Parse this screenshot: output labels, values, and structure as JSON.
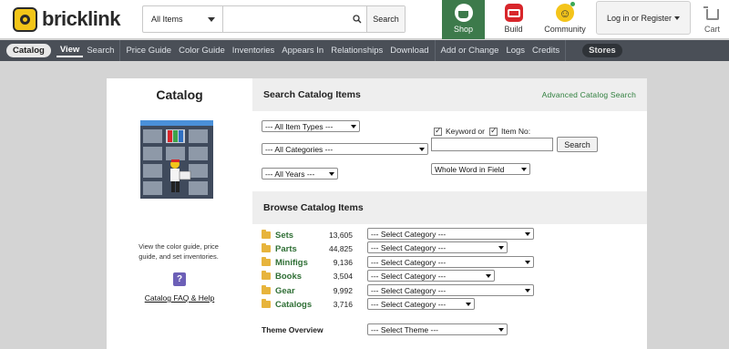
{
  "brand": {
    "name": "bricklink"
  },
  "header": {
    "search_type": "All Items",
    "search_placeholder": "",
    "search_button": "Search",
    "tiles": [
      {
        "label": "Shop",
        "icon": "shopping-bag-icon",
        "color": "#3d7a4b"
      },
      {
        "label": "Build",
        "icon": "toolbox-icon",
        "color": "#d8262b"
      },
      {
        "label": "Community",
        "icon": "smiley-icon",
        "color": "#f4c41a"
      }
    ],
    "login_label": "Log in or Register",
    "cart_label": "Cart"
  },
  "subnav": {
    "catalog": "Catalog",
    "view": "View",
    "search": "Search",
    "price_guide": "Price Guide",
    "color_guide": "Color Guide",
    "inventories": "Inventories",
    "appears_in": "Appears In",
    "relationships": "Relationships",
    "download": "Download",
    "add_or_change": "Add or Change",
    "logs": "Logs",
    "credits": "Credits",
    "stores": "Stores"
  },
  "left": {
    "title": "Catalog",
    "description": "View the color guide, price guide, and set inventories.",
    "faq_link": "Catalog FAQ & Help"
  },
  "search_section": {
    "title": "Search Catalog Items",
    "advanced_link": "Advanced Catalog Search",
    "item_types": "--- All Item Types ---",
    "categories": "--- All Categories ---",
    "years": "--- All Years ---",
    "keyword_label": "Keyword or",
    "item_no_label": "Item No:",
    "keyword_value": "",
    "search_button": "Search",
    "match_mode": "Whole Word in Field"
  },
  "browse_section": {
    "title": "Browse Catalog Items",
    "rows": [
      {
        "name": "Sets",
        "count": "13,605",
        "select": "--- Select Category ---"
      },
      {
        "name": "Parts",
        "count": "44,825",
        "select": "--- Select Category ---"
      },
      {
        "name": "Minifigs",
        "count": "9,136",
        "select": "--- Select Category ---"
      },
      {
        "name": "Books",
        "count": "3,504",
        "select": "--- Select Category ---"
      },
      {
        "name": "Gear",
        "count": "9,992",
        "select": "--- Select Category ---"
      },
      {
        "name": "Catalogs",
        "count": "3,716",
        "select": "--- Select Category ---"
      }
    ],
    "theme_label": "Theme Overview",
    "theme_select": "--- Select Theme ---"
  }
}
